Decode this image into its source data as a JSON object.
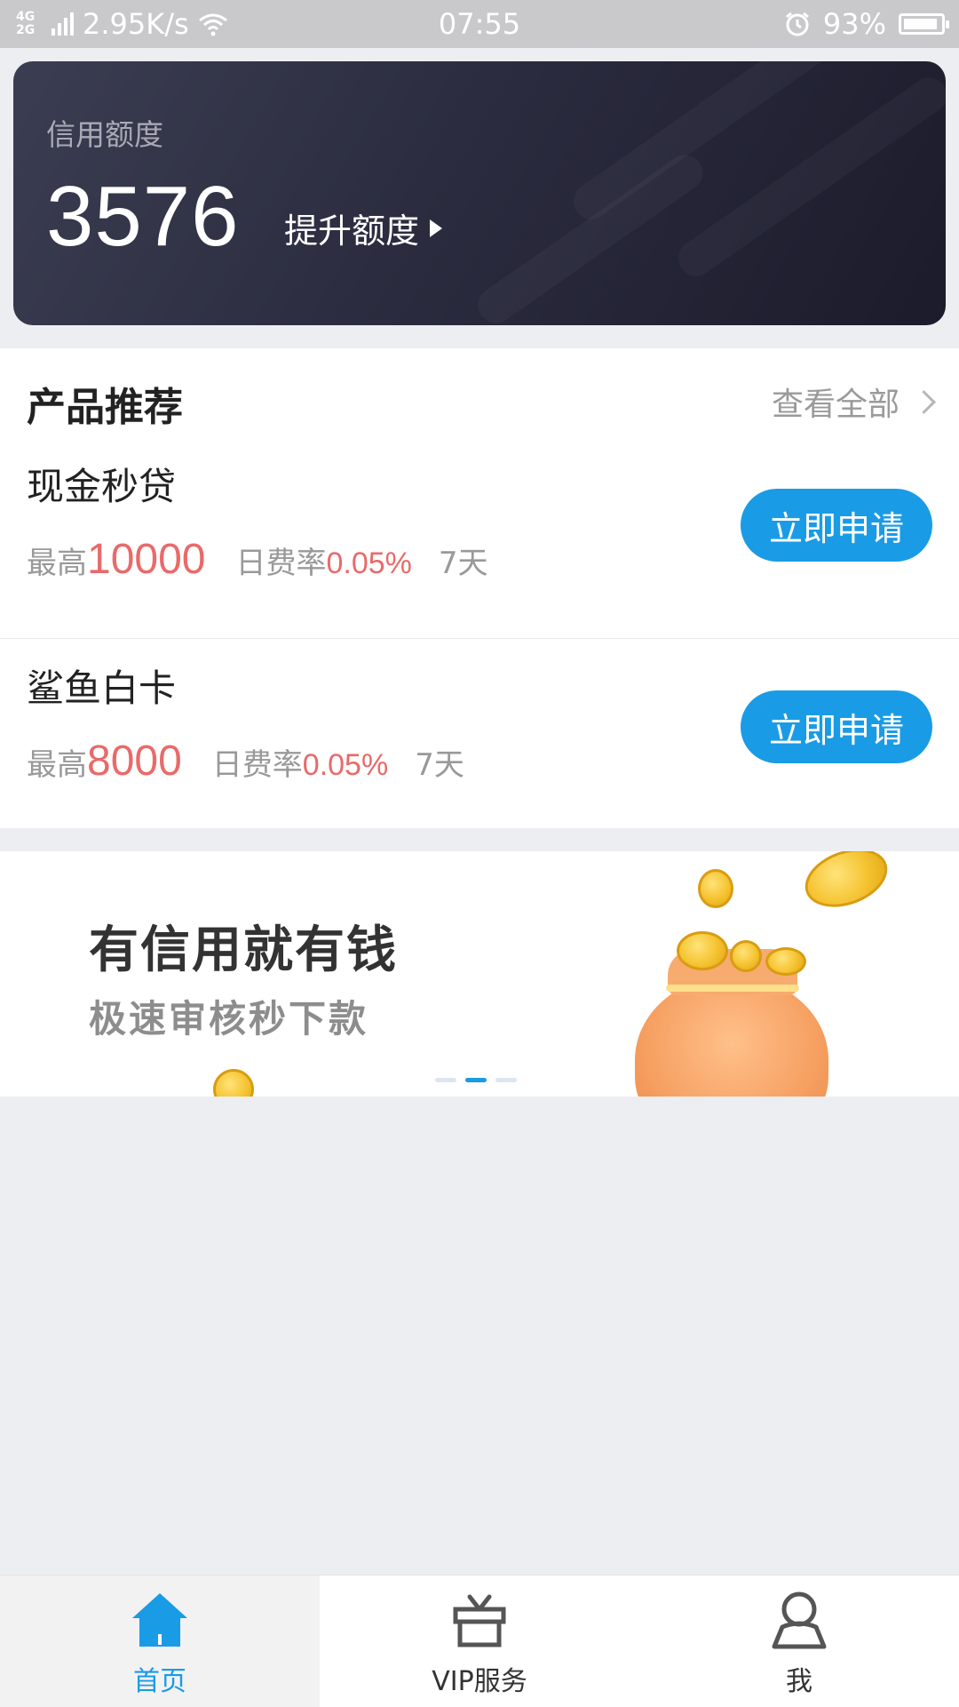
{
  "status_bar": {
    "network_type": "4G 2G",
    "speed": "2.95K/s",
    "time": "07:55",
    "battery": "93%",
    "battery_level": 0.93
  },
  "credit": {
    "label": "信用额度",
    "amount": "3576",
    "raise_label": "提升额度"
  },
  "products": {
    "title": "产品推荐",
    "view_all": "查看全部",
    "items": [
      {
        "name": "现金秒贷",
        "max_label": "最高",
        "max_amount": "10000",
        "rate_label": "日费率",
        "rate": "0.05%",
        "term": "7天",
        "apply_label": "立即申请"
      },
      {
        "name": "鲨鱼白卡",
        "max_label": "最高",
        "max_amount": "8000",
        "rate_label": "日费率",
        "rate": "0.05%",
        "term": "7天",
        "apply_label": "立即申请"
      }
    ]
  },
  "banner": {
    "title": "有信用就有钱",
    "subtitle": "极速审核秒下款",
    "active_slide": 2,
    "slide_count": 3
  },
  "bottom_nav": {
    "items": [
      {
        "label": "首页",
        "icon": "home-icon",
        "active": true
      },
      {
        "label": "VIP服务",
        "icon": "gift-icon",
        "active": false
      },
      {
        "label": "我",
        "icon": "user-icon",
        "active": false
      }
    ]
  },
  "colors": {
    "accent": "#1a9be6",
    "highlight": "#e96a6a",
    "card_dark": "#2b2c3f"
  }
}
